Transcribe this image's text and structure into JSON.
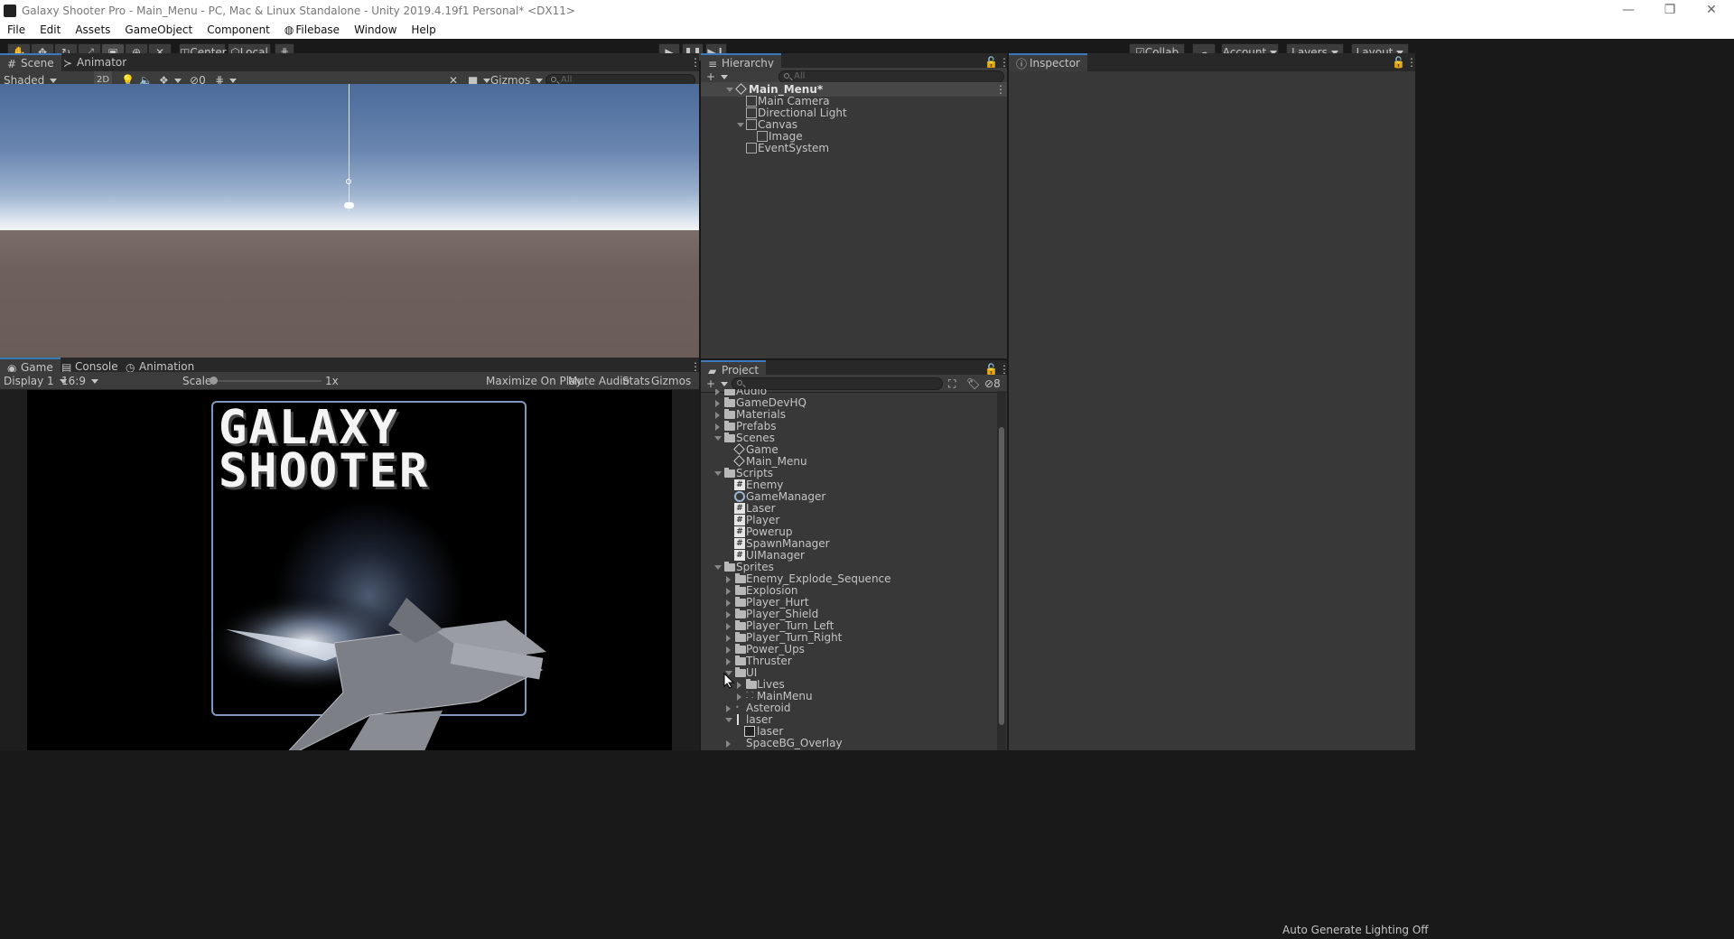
{
  "window": {
    "title": "Galaxy Shooter Pro - Main_Menu - PC, Mac & Linux Standalone - Unity 2019.4.19f1 Personal* <DX11>",
    "minimize": "—",
    "maximize": "❐",
    "close": "✕"
  },
  "menu": [
    "File",
    "Edit",
    "Assets",
    "GameObject",
    "Component",
    "Filebase",
    "Window",
    "Help"
  ],
  "toolbar": {
    "pivot": "Center",
    "space": "Local",
    "collab": "Collab",
    "account": "Account",
    "layers": "Layers",
    "layout": "Layout"
  },
  "scene_panel": {
    "tabs": [
      "Scene",
      "Animator"
    ],
    "shading": "Shaded",
    "mode_2d": "2D",
    "hidden_count": "0",
    "gizmos": "Gizmos",
    "search_placeholder": "All"
  },
  "game_panel": {
    "tabs": [
      "Game",
      "Console",
      "Animation"
    ],
    "display": "Display 1",
    "aspect": "16:9",
    "scale_label": "Scale",
    "scale_value": "1x",
    "maximize_on_play": "Maximize On Play",
    "mute_audio": "Mute Audio",
    "stats": "Stats",
    "gizmos": "Gizmos",
    "logo_line1": "GALAXY",
    "logo_line2": "SHOOTER"
  },
  "hierarchy": {
    "tab": "Hierarchy",
    "search_placeholder": "All",
    "root": "Main_Menu*",
    "items": [
      "Main Camera",
      "Directional Light",
      "Canvas",
      "Image",
      "EventSystem"
    ]
  },
  "inspector": {
    "tab": "Inspector"
  },
  "project": {
    "tab": "Project",
    "hidden_count": "8",
    "partial_top": "Audio",
    "folders_top": [
      "GameDevHQ",
      "Materials",
      "Prefabs"
    ],
    "scenes": {
      "label": "Scenes",
      "items": [
        "Game",
        "Main_Menu"
      ]
    },
    "scripts": {
      "label": "Scripts",
      "items": [
        "Enemy",
        "GameManager",
        "Laser",
        "Player",
        "Powerup",
        "SpawnManager",
        "UIManager"
      ]
    },
    "sprites": {
      "label": "Sprites",
      "folders": [
        "Enemy_Explode_Sequence",
        "Explosion",
        "Player_Hurt",
        "Player_Shield",
        "Player_Turn_Left",
        "Player_Turn_Right",
        "Power_Ups",
        "Thruster"
      ],
      "ui": {
        "label": "UI",
        "items": [
          "Lives",
          "MainMenu"
        ]
      },
      "assets": [
        "Asteroid",
        "laser",
        "laser",
        "SpaceBG_Overlay"
      ]
    }
  },
  "status": {
    "lighting": "Auto Generate Lighting Off"
  },
  "colors": {
    "accent": "#3a79bb",
    "panel": "#383838",
    "dark": "#191919",
    "sky": "#5f7ca6",
    "ground": "#6a5c57"
  }
}
